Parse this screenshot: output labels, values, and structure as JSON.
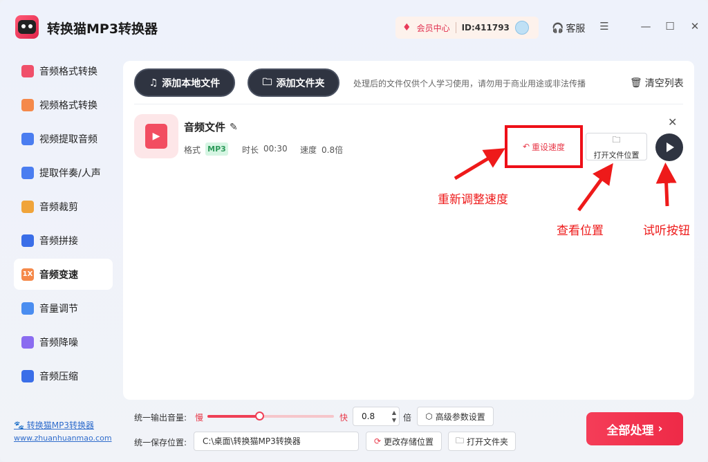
{
  "app": {
    "title": "转换猫MP3转换器",
    "member_center": "会员中心",
    "user_id": "ID:411793",
    "support": "客服"
  },
  "sidebar": {
    "items": [
      {
        "label": "音频格式转换",
        "icon": "audio-convert-icon",
        "color": "#f0506a"
      },
      {
        "label": "视频格式转换",
        "icon": "video-convert-icon",
        "color": "#f5894a"
      },
      {
        "label": "视频提取音频",
        "icon": "video-extract-icon",
        "color": "#4a7df0"
      },
      {
        "label": "提取伴奏/人声",
        "icon": "accompaniment-icon",
        "color": "#4a7df0"
      },
      {
        "label": "音频裁剪",
        "icon": "audio-trim-icon",
        "color": "#f0a43a"
      },
      {
        "label": "音频拼接",
        "icon": "audio-merge-icon",
        "color": "#3a6ee8"
      },
      {
        "label": "音频变速",
        "icon": "speed-icon",
        "color": "#f5894a",
        "badge": "1X"
      },
      {
        "label": "音量调节",
        "icon": "volume-icon",
        "color": "#4a8df0"
      },
      {
        "label": "音频降噪",
        "icon": "denoise-icon",
        "color": "#8a6cf0"
      },
      {
        "label": "音频压缩",
        "icon": "compress-icon",
        "color": "#3a6ee8"
      }
    ],
    "active_index": 6,
    "site_name": "转换猫MP3转换器",
    "site_url": "www.zhuanhuanmao.com"
  },
  "toolbar": {
    "add_file": "添加本地文件",
    "add_folder": "添加文件夹",
    "notice": "处理后的文件仅供个人学习使用，请勿用于商业用途或非法传播",
    "clear_list": "清空列表"
  },
  "file": {
    "name": "音频文件",
    "format_label": "格式",
    "format": "MP3",
    "duration_label": "时长",
    "duration": "00:30",
    "speed_label": "速度",
    "speed": "0.8倍",
    "reset_speed": "重设速度",
    "open_location": "打开文件位置"
  },
  "annotations": {
    "reset": "重新调整速度",
    "view_location": "查看位置",
    "listen": "试听按钮"
  },
  "bottom": {
    "volume_label": "统一输出音量:",
    "slow": "慢",
    "fast": "快",
    "speed_value": "0.8",
    "speed_fraction": 0.41,
    "times": "倍",
    "advanced": "高级参数设置",
    "save_label": "统一保存位置:",
    "save_path": "C:\\桌面\\转换猫MP3转换器",
    "change_location": "更改存储位置",
    "open_folder": "打开文件夹",
    "process_all": "全部处理"
  },
  "colors": {
    "accent": "#ef3f56",
    "dark_button": "#2f3441",
    "annotation": "#ee1a1a"
  }
}
